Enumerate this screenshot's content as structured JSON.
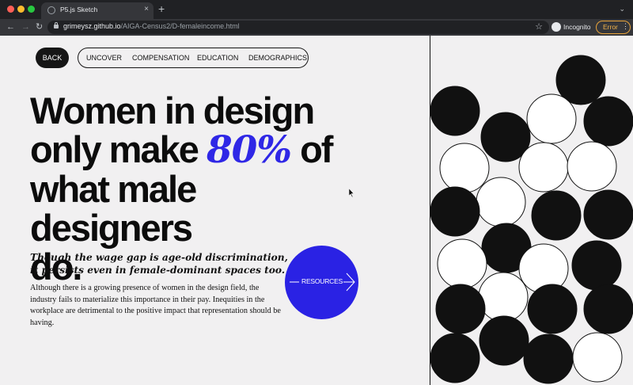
{
  "browser": {
    "tab_title": "P5.js Sketch",
    "tab_close": "×",
    "new_tab": "+",
    "tab_menu": "⌄",
    "url_host": "grimeysz.github.io",
    "url_path": "/AIGA-Census2/D-femaleincome.html",
    "profile_label": "Incognito",
    "error_label": "Error",
    "menu_dots": "⋮",
    "icons": {
      "back": "arrow-left",
      "forward": "arrow-right",
      "reload": "reload",
      "bookmark": "star"
    }
  },
  "nav": {
    "back_label": "BACK",
    "items": [
      {
        "label": "UNCOVER"
      },
      {
        "label": "COMPENSATION"
      },
      {
        "label": "EDUCATION"
      },
      {
        "label": "DEMOGRAPHICS"
      }
    ]
  },
  "headline": {
    "line1": "Women in design",
    "line2_before": "only make",
    "accent": "80%",
    "line2_after": "of",
    "line3": "what male designers",
    "line4": "do."
  },
  "subhead": "Though the wage gap is age-old discrimination, it persists even in female-dominant spaces too.",
  "body": "Although there is a growing presence of women in the design field, the industry fails to materialize this importance in their pay. Inequities in the workplace are detrimental to the positive impact that representation should be having.",
  "resources": {
    "label": "RESOURCES",
    "color": "#2a22e4"
  },
  "colors": {
    "accent": "#2f27e6",
    "page_bg": "#f1f0f1",
    "ink": "#111111"
  },
  "circle_grid": {
    "filled_count": 12,
    "outline_count": 11
  }
}
